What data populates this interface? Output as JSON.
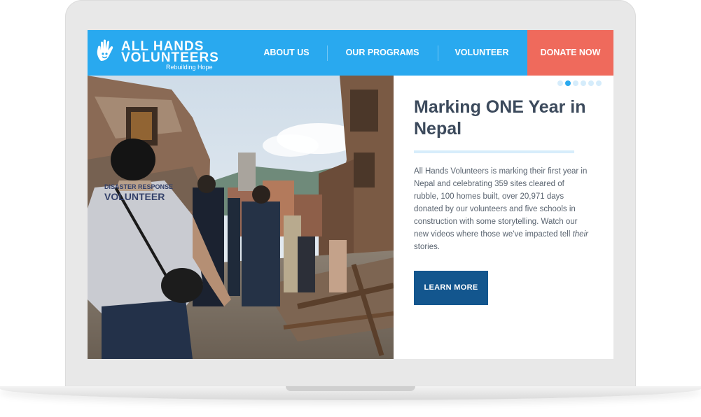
{
  "logo": {
    "line1": "ALL HANDS",
    "line2": "VOLUNTEERS",
    "tagline": "Rebuilding Hope"
  },
  "nav": {
    "items": [
      {
        "label": "ABOUT US"
      },
      {
        "label": "OUR PROGRAMS"
      },
      {
        "label": "VOLUNTEER"
      }
    ],
    "donate_label": "DONATE NOW"
  },
  "hero": {
    "shirt_text_1": "DISASTER RESPONSE",
    "shirt_text_2": "VOLUNTEER",
    "slide_count": 6,
    "active_slide": 2,
    "headline": "Marking ONE Year in Nepal",
    "body_before": "All Hands Volunteers is marking their first year in Nepal and celebrating 359 sites cleared of rubble, 100 homes built, over 20,971 days donated by our volunteers and five schools in construction with some storytelling. Watch our new videos where those we've impacted tell ",
    "body_em": "their",
    "body_after": " stories.",
    "cta_label": "LEARN MORE"
  },
  "colors": {
    "nav": "#29a9ef",
    "donate": "#ef6a5c",
    "cta": "#13568e",
    "headline": "#3c4a5c"
  }
}
